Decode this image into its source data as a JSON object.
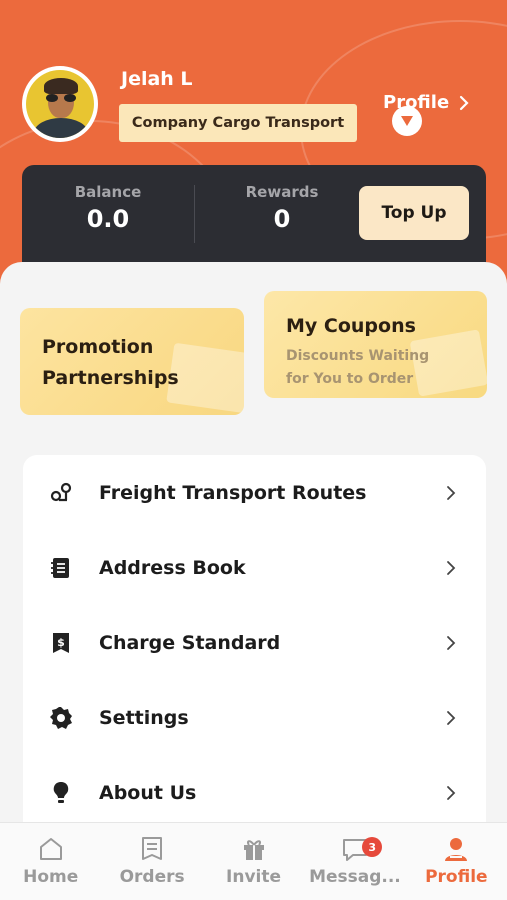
{
  "user": {
    "name": "Jelah L",
    "company": "Company Cargo Transport",
    "profile_link": "Profile"
  },
  "wallet": {
    "balance_label": "Balance",
    "balance_value": "0.0",
    "rewards_label": "Rewards",
    "rewards_value": "0",
    "topup_label": "Top Up"
  },
  "cards": {
    "promo_title": "Promotion Partnerships",
    "coupons_title": "My Coupons",
    "coupons_subtitle": "Discounts Waiting for You to Order"
  },
  "menu": [
    {
      "label": "Freight Transport Routes",
      "icon": "route-icon"
    },
    {
      "label": "Address Book",
      "icon": "address-book-icon"
    },
    {
      "label": "Charge Standard",
      "icon": "price-tag-icon"
    },
    {
      "label": "Settings",
      "icon": "gear-icon"
    },
    {
      "label": "About Us",
      "icon": "lightbulb-icon"
    }
  ],
  "tabs": [
    {
      "label": "Home",
      "icon": "home-icon"
    },
    {
      "label": "Orders",
      "icon": "orders-icon"
    },
    {
      "label": "Invite",
      "icon": "gift-icon"
    },
    {
      "label": "Messag...",
      "icon": "message-icon",
      "badge": "3"
    },
    {
      "label": "Profile",
      "icon": "profile-icon",
      "active": true
    }
  ],
  "colors": {
    "accent": "#ec6a3d",
    "dark_card": "#2c2d33",
    "badge": "#e6493b"
  }
}
